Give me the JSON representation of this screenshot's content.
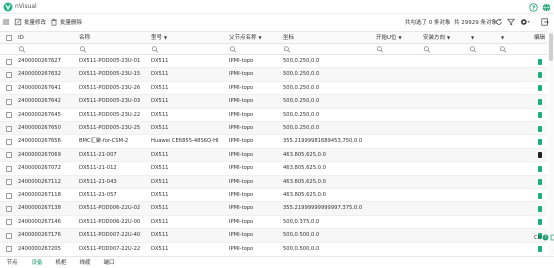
{
  "window": {
    "title": "nVisual"
  },
  "toolbar": {
    "batch_edit": "批量修改",
    "batch_delete": "批量删除",
    "selected_info": "共勾选了 0 条对象",
    "total_info": "共 29929 条对象"
  },
  "columns": [
    "ID",
    "名称",
    "型号",
    "父节点名称",
    "坐标",
    "开始U位",
    "安装方向",
    "",
    "",
    "编辑"
  ],
  "rows": [
    {
      "id": "2400000267627",
      "name": "DX511-POD005-23U-01",
      "model": "DX511",
      "parent": "IPMI-topo",
      "coord": "500,0.250,0.0"
    },
    {
      "id": "2400000267632",
      "name": "DX511-POD005-23U-15",
      "model": "DX511",
      "parent": "IPMI-topo",
      "coord": "500,0.250,0.0"
    },
    {
      "id": "2400000267641",
      "name": "DX511-POD005-23U-26",
      "model": "DX511",
      "parent": "IPMI-topo",
      "coord": "500,0.250,0.0"
    },
    {
      "id": "2400000267642",
      "name": "DX511-POD005-23U-03",
      "model": "DX511",
      "parent": "IPMI-topo",
      "coord": "500,0.250,0.0"
    },
    {
      "id": "2400000267645",
      "name": "DX511-POD005-23U-22",
      "model": "DX511",
      "parent": "IPMI-topo",
      "coord": "500,0.250,0.0"
    },
    {
      "id": "2400000267650",
      "name": "DX511-POD005-23U-25",
      "model": "DX511",
      "parent": "IPMI-topo",
      "coord": "500,0.250,0.0"
    },
    {
      "id": "2400000267656",
      "name": "BMC汇聚-for-CSM-2",
      "model": "Huawei CE6855-48S6Q-HI",
      "parent": "IPMI-topo",
      "coord": "355.21999981689453,750,0.0"
    },
    {
      "id": "2400000267069",
      "name": "DX511-21-007",
      "model": "DX511",
      "parent": "IPMI-topo",
      "coord": "463.805,625,0.0"
    },
    {
      "id": "2400000267072",
      "name": "DX511-21-012",
      "model": "DX511",
      "parent": "IPMI-topo",
      "coord": "463.805,625,0.0"
    },
    {
      "id": "2400000267112",
      "name": "DX511-21-043",
      "model": "DX511",
      "parent": "IPMI-topo",
      "coord": "463.805,625,0.0"
    },
    {
      "id": "2400000267118",
      "name": "DX511-21-057",
      "model": "DX511",
      "parent": "IPMI-topo",
      "coord": "463.805,625,0.0"
    },
    {
      "id": "2400000267138",
      "name": "DX511-POD006-22U-02",
      "model": "DX511",
      "parent": "IPMI-topo",
      "coord": "355.21999999999997,375,0.0"
    },
    {
      "id": "2400000267146",
      "name": "DX511-POD006-22U-00",
      "model": "DX511",
      "parent": "IPMI-topo",
      "coord": "500,0.375,0.0"
    },
    {
      "id": "2400000267176",
      "name": "DX511-POD007-22U-40",
      "model": "DX511",
      "parent": "IPMI-topo",
      "coord": "500,0.500,0.0"
    },
    {
      "id": "2400000267205",
      "name": "DX511-POD007-22U-22",
      "model": "DX511",
      "parent": "IPMI-topo",
      "coord": "500,0.500,0.0"
    }
  ],
  "tabs": [
    "节点",
    "设备",
    "机柜",
    "线缆",
    "端口"
  ],
  "active_tab": "设备",
  "colors": {
    "accent": "#1a9e6f",
    "logo": "#2bb38a",
    "edit_icon": "#1ab07a"
  },
  "icons": [
    "menu-icon",
    "help-icon",
    "globe-icon",
    "edit-icon",
    "delete-icon",
    "refresh-icon",
    "filter-icon",
    "settings-icon",
    "export-icon",
    "search-icon"
  ]
}
